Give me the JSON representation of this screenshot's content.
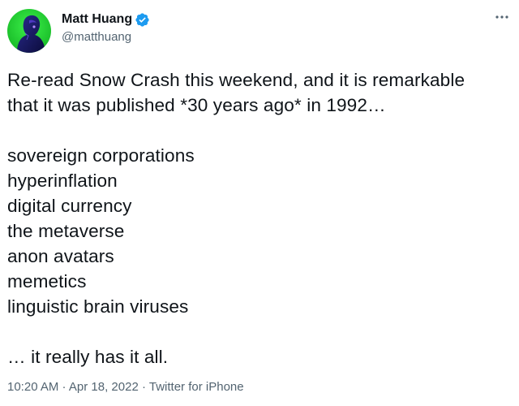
{
  "author": {
    "display_name": "Matt Huang",
    "handle": "@matthuang",
    "avatar_icon": "avatar-image",
    "verified_icon": "verified-badge-icon",
    "verified_color": "#1d9bf0"
  },
  "menu": {
    "icon": "more-options-icon"
  },
  "tweet": {
    "intro_line1": "Re-read Snow Crash this weekend, and it is remarkable",
    "intro_line2": "that it was published *30 years ago* in 1992…",
    "list": [
      "sovereign corporations",
      "hyperinflation",
      "digital currency",
      "the metaverse",
      "anon avatars",
      "memetics",
      "linguistic brain viruses"
    ],
    "closing": "… it really has it all."
  },
  "meta": {
    "time": "10:20 AM",
    "separator1": " · ",
    "date": "Apr 18, 2022",
    "separator2": " · ",
    "source": "Twitter for iPhone"
  },
  "colors": {
    "text": "#0f1419",
    "secondary": "#536471",
    "avatar_bg": "#1fd12f"
  }
}
